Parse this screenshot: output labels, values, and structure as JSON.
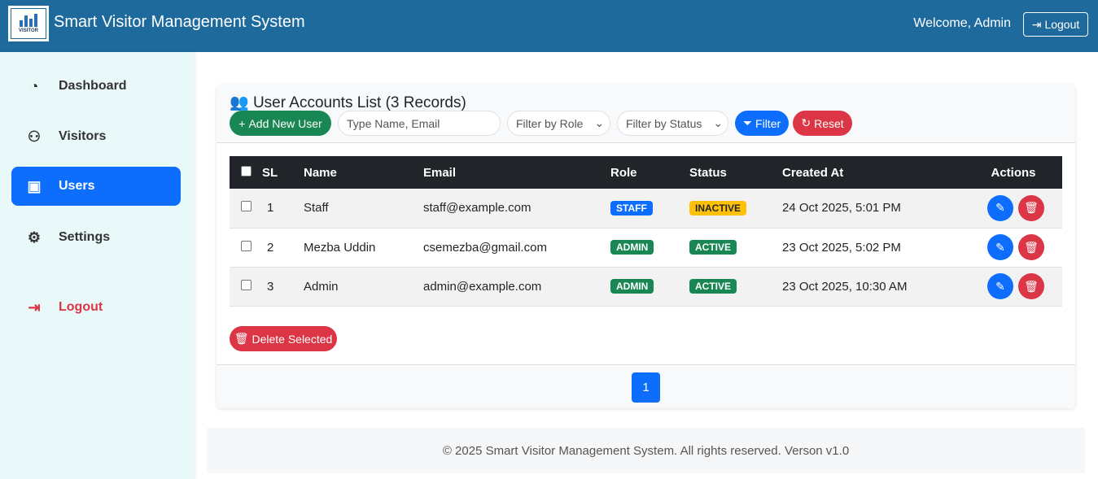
{
  "header": {
    "title": "Smart Visitor Management System",
    "logo_text": "VISITOR",
    "welcome": "Welcome, Admin",
    "logout": "Logout"
  },
  "sidebar": {
    "items": [
      {
        "label": "Dashboard",
        "icon": "gauge-icon"
      },
      {
        "label": "Visitors",
        "icon": "people-icon"
      },
      {
        "label": "Users",
        "icon": "person-badge-icon",
        "active": true
      },
      {
        "label": "Settings",
        "icon": "gear-icon"
      },
      {
        "label": "Logout",
        "icon": "logout-icon"
      }
    ]
  },
  "card": {
    "title": "User Accounts List (3 Records)",
    "add_user": "Add New User",
    "search_placeholder": "Type Name, Email",
    "role_filter": "Filter by Role",
    "status_filter": "Filter by Status",
    "filter": "Filter",
    "reset": "Reset",
    "delete_selected": "Delete Selected"
  },
  "table": {
    "columns": [
      "SL",
      "Name",
      "Email",
      "Role",
      "Status",
      "Created At",
      "Actions"
    ],
    "rows": [
      {
        "sl": "1",
        "name": "Staff",
        "email": "staff@example.com",
        "role": "STAFF",
        "status": "INACTIVE",
        "created": "24 Oct 2025, 5:01 PM"
      },
      {
        "sl": "2",
        "name": "Mezba Uddin",
        "email": "csemezba@gmail.com",
        "role": "ADMIN",
        "status": "ACTIVE",
        "created": "23 Oct 2025, 5:02 PM"
      },
      {
        "sl": "3",
        "name": "Admin",
        "email": "admin@example.com",
        "role": "ADMIN",
        "status": "ACTIVE",
        "created": "23 Oct 2025, 10:30 AM"
      }
    ]
  },
  "pagination": {
    "current": "1"
  },
  "footer": "© 2025 Smart Visitor Management System. All rights reserved. Verson v1.0",
  "colors": {
    "header": "#1e6a9c",
    "primary": "#0d6efd",
    "success": "#198754",
    "danger": "#dc3545",
    "warning": "#ffc107"
  }
}
